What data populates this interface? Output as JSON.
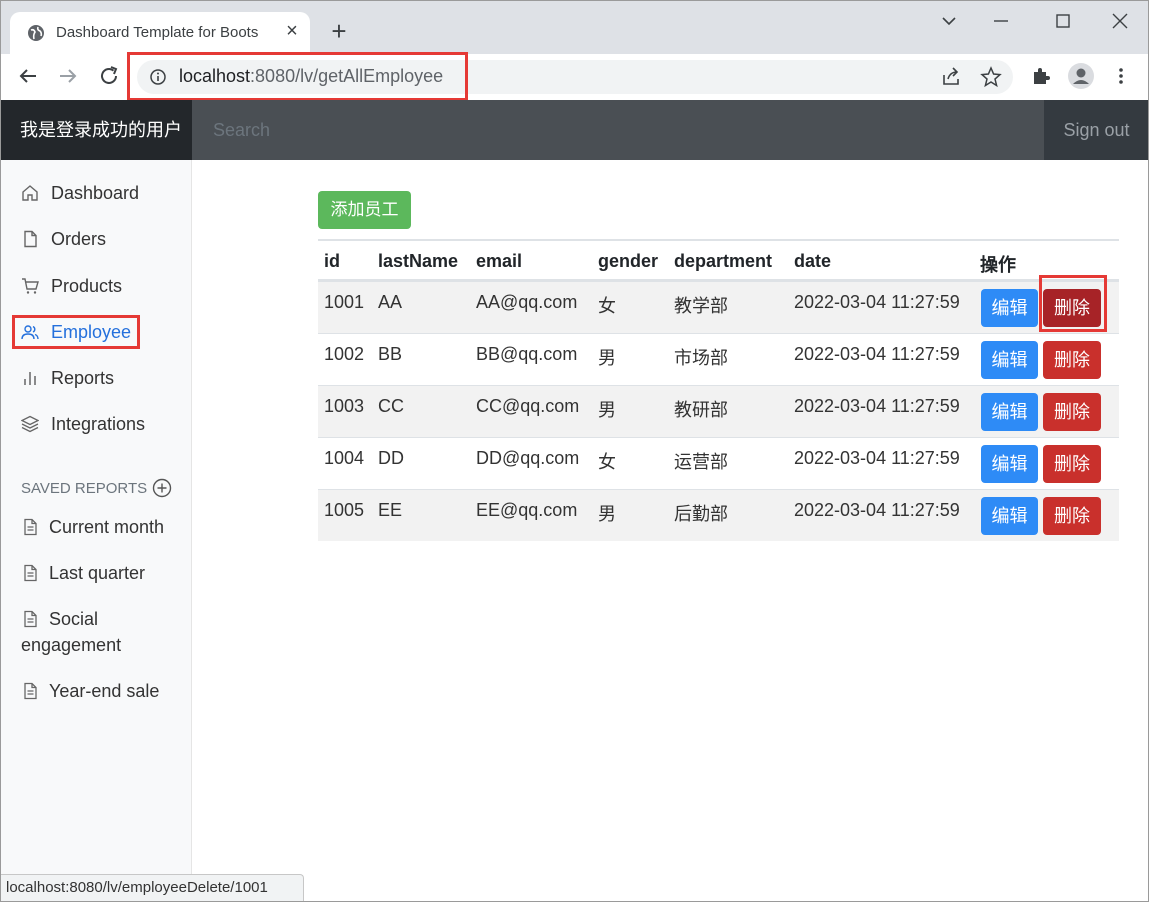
{
  "browser": {
    "tab_title": "Dashboard Template for Boots",
    "url_host": "localhost",
    "url_rest": ":8080/lv/getAllEmployee",
    "status_url": "localhost:8080/lv/employeeDelete/1001"
  },
  "header": {
    "brand": "我是登录成功的用户",
    "search_placeholder": "Search",
    "signout": "Sign out"
  },
  "sidebar": {
    "items": [
      {
        "label": "Dashboard",
        "icon": "home-icon"
      },
      {
        "label": "Orders",
        "icon": "file-icon"
      },
      {
        "label": "Products",
        "icon": "cart-icon"
      },
      {
        "label": "Employee",
        "icon": "users-icon",
        "active": true
      },
      {
        "label": "Reports",
        "icon": "bar-chart-icon"
      },
      {
        "label": "Integrations",
        "icon": "layers-icon"
      }
    ],
    "saved_heading": "SAVED REPORTS",
    "saved_reports": [
      "Current month",
      "Last quarter",
      "Social engagement",
      "Year-end sale"
    ]
  },
  "main": {
    "add_button": "添加员工",
    "columns": [
      "id",
      "lastName",
      "email",
      "gender",
      "department",
      "date",
      "操作"
    ],
    "edit_label": "编辑",
    "delete_label": "删除",
    "rows": [
      {
        "id": "1001",
        "lastName": "AA",
        "email": "AA@qq.com",
        "gender": "女",
        "department": "教学部",
        "date": "2022-03-04 11:27:59"
      },
      {
        "id": "1002",
        "lastName": "BB",
        "email": "BB@qq.com",
        "gender": "男",
        "department": "市场部",
        "date": "2022-03-04 11:27:59"
      },
      {
        "id": "1003",
        "lastName": "CC",
        "email": "CC@qq.com",
        "gender": "男",
        "department": "教研部",
        "date": "2022-03-04 11:27:59"
      },
      {
        "id": "1004",
        "lastName": "DD",
        "email": "DD@qq.com",
        "gender": "女",
        "department": "运营部",
        "date": "2022-03-04 11:27:59"
      },
      {
        "id": "1005",
        "lastName": "EE",
        "email": "EE@qq.com",
        "gender": "男",
        "department": "后勤部",
        "date": "2022-03-04 11:27:59"
      }
    ]
  },
  "colors": {
    "highlight": "#e53935",
    "active_nav": "#2470dc",
    "edit_button": "#2e8bf6",
    "delete_button": "#c9302c",
    "add_button": "#5cb85c"
  }
}
